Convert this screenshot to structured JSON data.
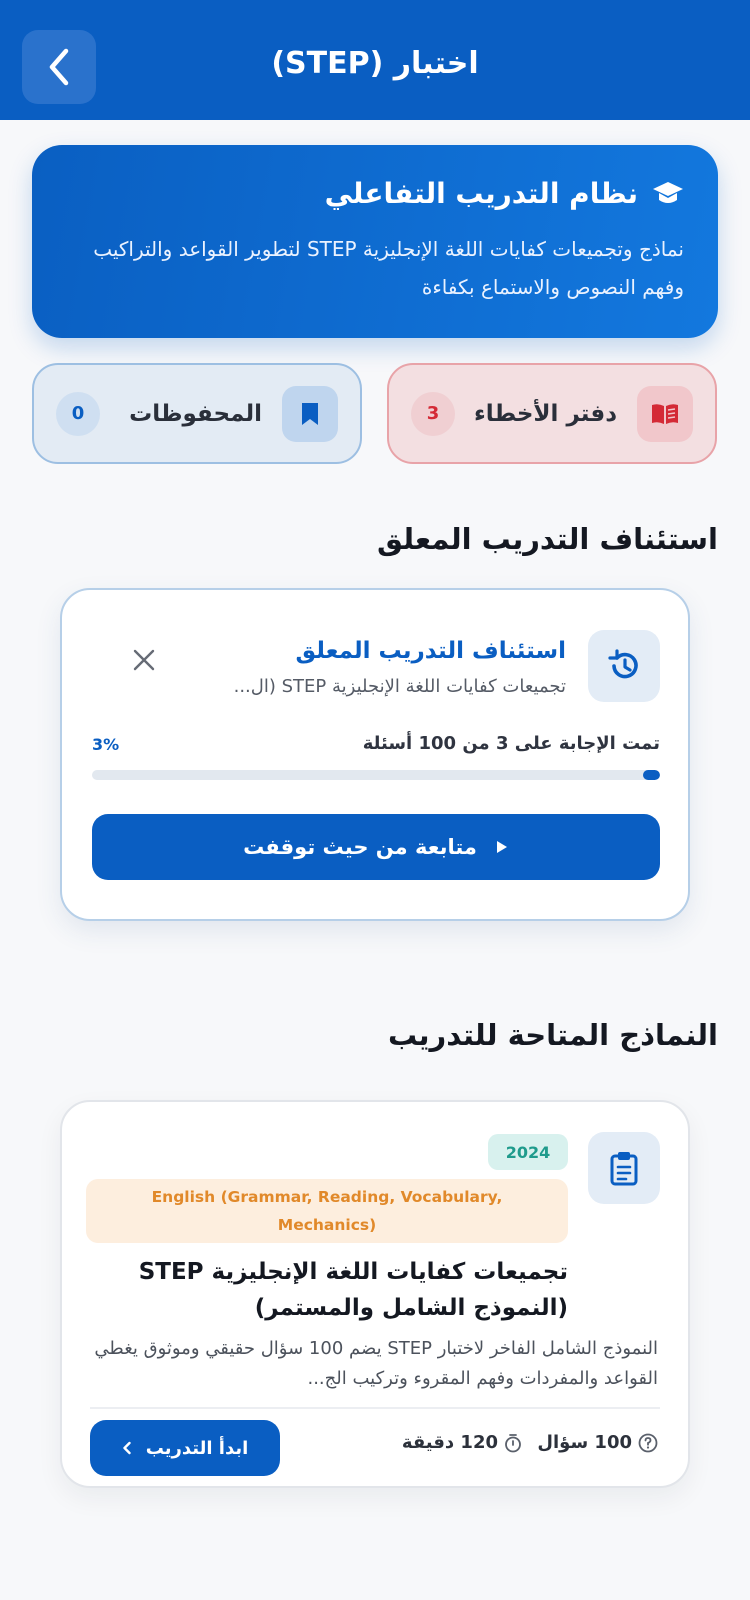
{
  "header": {
    "title": "اختبار (STEP)",
    "back_icon": "chevron-left-icon"
  },
  "hero": {
    "icon": "graduation-cap-icon",
    "title": "نظام التدريب التفاعلي",
    "description": "نماذج وتجميعات كفايات اللغة الإنجليزية STEP لتطوير القواعد والتراكيب وفهم النصوص والاستماع بكفاءة"
  },
  "stats": {
    "mistakes": {
      "label": "دفتر الأخطاء",
      "count": "3",
      "icon": "open-book-icon",
      "color": "#d42a36"
    },
    "saved": {
      "label": "المحفوظات",
      "count": "0",
      "icon": "bookmark-icon",
      "color": "#0a5ec2"
    }
  },
  "resume_section": {
    "heading": "استئناف التدريب المعلق",
    "card": {
      "icon": "history-icon",
      "title": "استئناف التدريب المعلق",
      "subtitle": "تجميعات كفايات اللغة الإنجليزية STEP (ال...",
      "progress_text": "تمت الإجابة على 3 من 100 أسئلة",
      "progress_percent_label": "3%",
      "progress_fraction": 0.03,
      "continue_label": "متابعة من حيث توقفت"
    }
  },
  "models_section": {
    "heading": "النماذج المتاحة للتدريب",
    "items": [
      {
        "icon": "clipboard-icon",
        "year": "2024",
        "subject": "English (Grammar, Reading, Vocabulary, Mechanics)",
        "title": "تجميعات كفايات اللغة الإنجليزية STEP (النموذج الشامل والمستمر)",
        "description": "النموذج الشامل الفاخر لاختبار STEP يضم 100 سؤال حقيقي وموثوق يغطي القواعد والمفردات وفهم المقروء وتركيب الج...",
        "questions": "100 سؤال",
        "duration": "120 دقيقة",
        "start_label": "ابدأ التدريب"
      }
    ]
  },
  "colors": {
    "primary": "#0a5ec2",
    "danger": "#d42a36",
    "teal": "#1f9b8c",
    "orange": "#e1892a"
  }
}
